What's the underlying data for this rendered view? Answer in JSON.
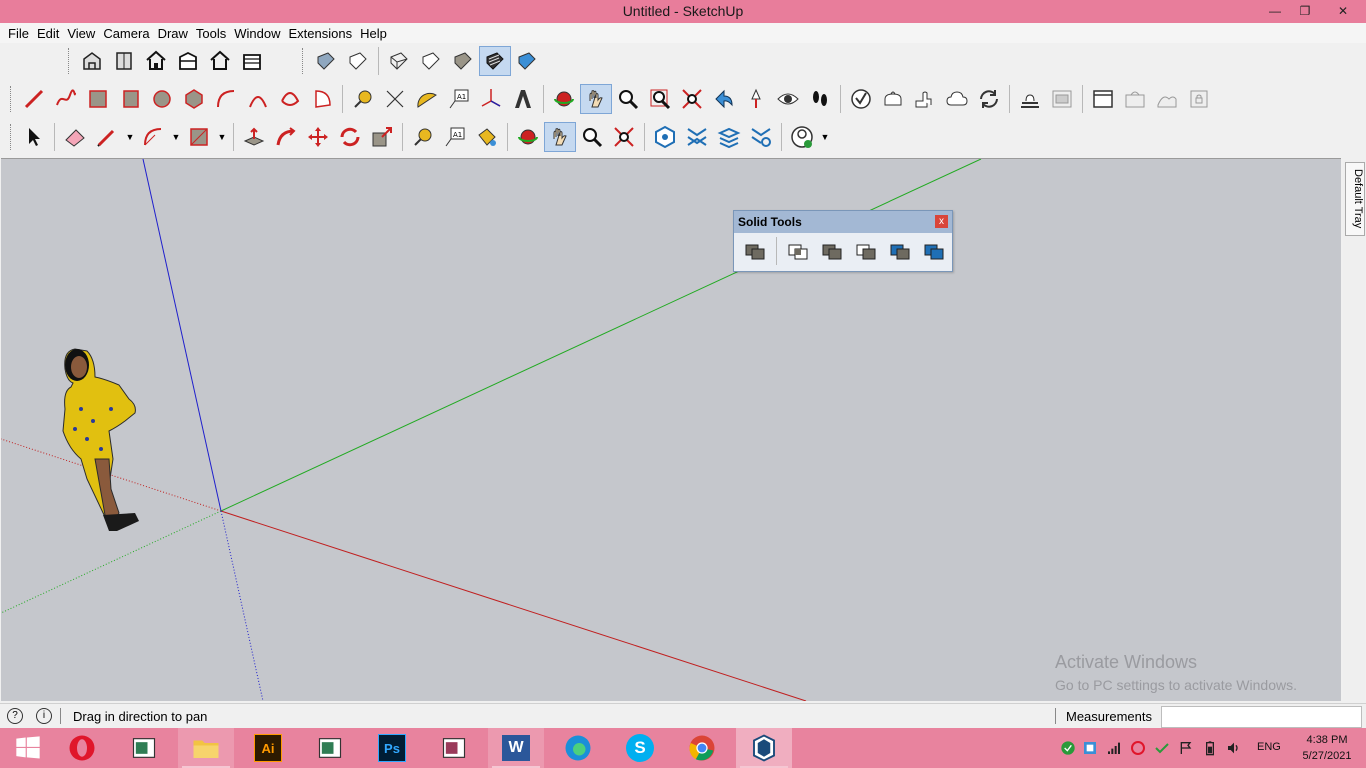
{
  "window": {
    "title": "Untitled - SketchUp",
    "minimize": "—",
    "maximize": "❐",
    "close": "✕"
  },
  "menu": [
    "File",
    "Edit",
    "View",
    "Camera",
    "Draw",
    "Tools",
    "Window",
    "Extensions",
    "Help"
  ],
  "tray": {
    "label": "Default Tray"
  },
  "solid_tools": {
    "title": "Solid Tools",
    "close": "x"
  },
  "watermark": {
    "line1": "Activate Windows",
    "line2": "Go to PC settings to activate Windows."
  },
  "status": {
    "message": "Drag in direction to pan",
    "measurements_label": "Measurements",
    "measurements_value": ""
  },
  "taskbar": {
    "apps": [
      "start-icon",
      "opera-icon",
      "file-icon",
      "file-explorer-icon",
      "illustrator-icon",
      "file-icon",
      "photoshop-icon",
      "file-icon",
      "word-icon",
      "edge-icon",
      "skype-icon",
      "chrome-icon",
      "sketchup-icon"
    ],
    "illustrator_text": "Ai",
    "photoshop_text": "Ps",
    "word_text": "W",
    "skype_text": "S",
    "language": "ENG",
    "time": "4:38 PM",
    "date": "5/27/2021"
  },
  "colors": {
    "titlebar": "#e87d9b",
    "viewport": "#c5c7cc",
    "axis_red": "#c02020",
    "axis_green": "#22aa22",
    "axis_blue": "#1f1fcc",
    "taskbar": "#e8839e"
  }
}
